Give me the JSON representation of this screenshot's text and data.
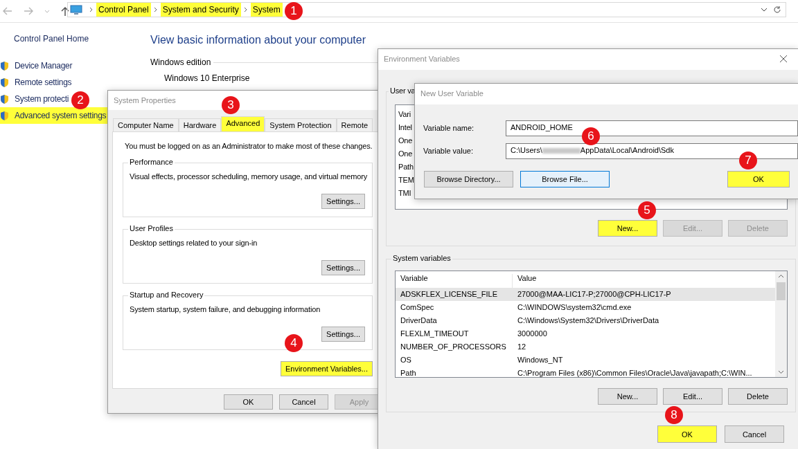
{
  "address_bar": {
    "breadcrumbs": [
      {
        "label": "Control Panel",
        "highlighted": true
      },
      {
        "label": "System and Security",
        "highlighted": true
      },
      {
        "label": "System",
        "highlighted": true
      }
    ]
  },
  "sidebar": {
    "home": "Control Panel Home",
    "items": [
      {
        "label": "Device Manager",
        "highlighted": false
      },
      {
        "label": "Remote settings",
        "highlighted": false
      },
      {
        "label": "System protecti",
        "highlighted": false
      },
      {
        "label": "Advanced system settings",
        "highlighted": true
      }
    ]
  },
  "main": {
    "heading": "View basic information about your computer",
    "section": "Windows edition",
    "edition": "Windows 10 Enterprise"
  },
  "system_properties": {
    "title": "System Properties",
    "tabs": [
      {
        "label": "Computer Name",
        "selected": false,
        "highlighted": false
      },
      {
        "label": "Hardware",
        "selected": false,
        "highlighted": false
      },
      {
        "label": "Advanced",
        "selected": true,
        "highlighted": true
      },
      {
        "label": "System Protection",
        "selected": false,
        "highlighted": false
      },
      {
        "label": "Remote",
        "selected": false,
        "highlighted": false
      }
    ],
    "notice": "You must be logged on as an Administrator to make most of these changes.",
    "groups": [
      {
        "title": "Performance",
        "description": "Visual effects, processor scheduling, memory usage, and virtual memory",
        "button": "Settings..."
      },
      {
        "title": "User Profiles",
        "description": "Desktop settings related to your sign-in",
        "button": "Settings..."
      },
      {
        "title": "Startup and Recovery",
        "description": "System startup, system failure, and debugging information",
        "button": "Settings..."
      }
    ],
    "env_button": {
      "label": "Environment Variables...",
      "highlighted": true
    },
    "buttons": [
      {
        "label": "OK",
        "disabled": false
      },
      {
        "label": "Cancel",
        "disabled": false
      },
      {
        "label": "Apply",
        "disabled": true
      }
    ]
  },
  "environment_variables": {
    "title": "Environment Variables",
    "user_group": {
      "title": "User va",
      "header": "Vari",
      "rows": [
        "Intel",
        "One",
        "One",
        "Path",
        "TEM",
        "TMI"
      ],
      "buttons": [
        {
          "label": "New...",
          "disabled": false,
          "highlighted": true
        },
        {
          "label": "Edit...",
          "disabled": true,
          "highlighted": false
        },
        {
          "label": "Delete",
          "disabled": true,
          "highlighted": false
        }
      ]
    },
    "system_group": {
      "title": "System variables",
      "columns": [
        "Variable",
        "Value"
      ],
      "rows": [
        {
          "variable": "ADSKFLEX_LICENSE_FILE",
          "value": "27000@MAA-LIC17-P;27000@CPH-LIC17-P",
          "selected": true
        },
        {
          "variable": "ComSpec",
          "value": "C:\\WINDOWS\\system32\\cmd.exe",
          "selected": false
        },
        {
          "variable": "DriverData",
          "value": "C:\\Windows\\System32\\Drivers\\DriverData",
          "selected": false
        },
        {
          "variable": "FLEXLM_TIMEOUT",
          "value": "3000000",
          "selected": false
        },
        {
          "variable": "NUMBER_OF_PROCESSORS",
          "value": "12",
          "selected": false
        },
        {
          "variable": "OS",
          "value": "Windows_NT",
          "selected": false
        },
        {
          "variable": "Path",
          "value": "C:\\Program Files (x86)\\Common Files\\Oracle\\Java\\javapath;C:\\WIN...",
          "selected": false
        }
      ],
      "buttons": [
        {
          "label": "New...",
          "disabled": false,
          "highlighted": false
        },
        {
          "label": "Edit...",
          "disabled": false,
          "highlighted": false
        },
        {
          "label": "Delete",
          "disabled": false,
          "highlighted": false
        }
      ]
    },
    "buttons": [
      {
        "label": "OK",
        "highlighted": true
      },
      {
        "label": "Cancel",
        "highlighted": false
      }
    ]
  },
  "new_user_variable": {
    "title": "New User Variable",
    "fields": [
      {
        "label": "Variable name:",
        "value": "ANDROID_HOME"
      },
      {
        "label": "Variable value:",
        "value_before": "C:\\Users\\",
        "value_after": "AppData\\Local\\Android\\Sdk"
      }
    ],
    "buttons": [
      {
        "label": "Browse Directory...",
        "focused": false,
        "highlighted": false
      },
      {
        "label": "Browse File...",
        "focused": true,
        "highlighted": false
      },
      {
        "label": "OK",
        "focused": false,
        "highlighted": true
      }
    ]
  },
  "callouts": [
    {
      "label": "1"
    },
    {
      "label": "2"
    },
    {
      "label": "3"
    },
    {
      "label": "4"
    },
    {
      "label": "5"
    },
    {
      "label": "6"
    },
    {
      "label": "7"
    },
    {
      "label": "8"
    }
  ]
}
